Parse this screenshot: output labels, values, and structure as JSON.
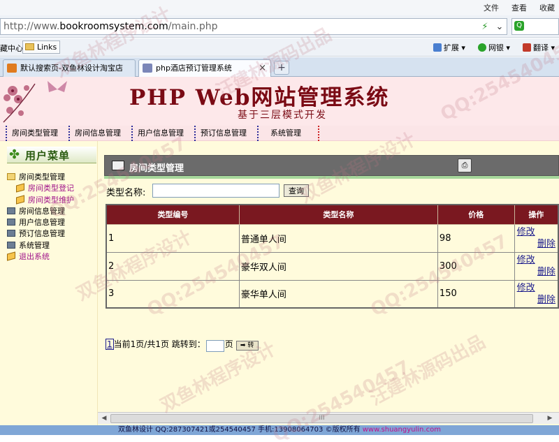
{
  "browser": {
    "menu": [
      "文件",
      "查看",
      "收藏"
    ],
    "url_prefix": "http://www.",
    "url_domain": "bookroomsystem.com",
    "url_path": "/main.php",
    "fav_left": "藏中心",
    "fav_links": "Links",
    "toolbar_right": [
      "扩展",
      "网银",
      "翻译"
    ],
    "tabs": [
      {
        "label": "默认搜索页-双鱼林设计淘宝店"
      },
      {
        "label": "php酒店预订管理系统"
      }
    ],
    "new_tab": "+"
  },
  "banner": {
    "title": "PHP Web网站管理系统",
    "subtitle": "基于三层模式开发"
  },
  "nav": [
    "房间类型管理",
    "房间信息管理",
    "用户信息管理",
    "预订信息管理",
    "系统管理"
  ],
  "sidebar": {
    "title": "用户菜单",
    "tree": {
      "room_type": "房间类型管理",
      "room_type_add": "房间类型登记",
      "room_type_maintain": "房间类型维护",
      "room_info": "房间信息管理",
      "user_info": "用户信息管理",
      "booking_info": "预订信息管理",
      "system": "系统管理",
      "logout": "退出系统"
    }
  },
  "panel": {
    "title": "房间类型管理",
    "search_label": "类型名称:",
    "search_value": "",
    "search_button": "查询"
  },
  "table": {
    "headers": [
      "类型编号",
      "类型名称",
      "价格",
      "操作"
    ],
    "rows": [
      {
        "id": "1",
        "name": "普通单人间",
        "price": "98"
      },
      {
        "id": "2",
        "name": "豪华双人间",
        "price": "300"
      },
      {
        "id": "3",
        "name": "豪华单人间",
        "price": "150"
      }
    ],
    "edit_label": "修改",
    "delete_label": "删除"
  },
  "pager": {
    "page_link": "1",
    "text": "当前1页/共1页 跳转到：",
    "suffix": "页",
    "go": "➡ 转"
  },
  "scrollbar_grip": "III",
  "footer": {
    "text": "双鱼林设计 QQ:287307421或254540457 手机:13908064703 ©版权所有 ",
    "url": "www.shuangyulin.com"
  },
  "watermarks": [
    "双鱼林程序设计",
    "汪建林源码出品",
    "QQ:254540457"
  ]
}
